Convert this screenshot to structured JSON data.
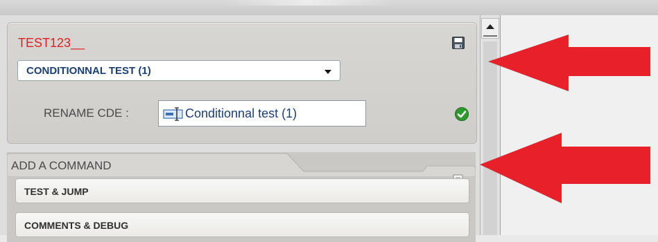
{
  "cde_panel": {
    "name": "TEST123__",
    "selected_command": "CONDITIONNAL TEST (1)",
    "rename_label": "RENAME CDE :",
    "rename_value": "Conditionnal test (1)"
  },
  "add_command": {
    "title": "ADD A COMMAND",
    "items": [
      "TEST & JUMP",
      "COMMENTS & DEBUG"
    ]
  },
  "icons": {
    "save": "floppy-disk-icon",
    "status": "green-checkmark-icon",
    "field": "text-field-icon",
    "minimize": "minimize-icon",
    "restore": "restore-icon",
    "scroll_up": "scroll-up-arrow-icon"
  },
  "colors": {
    "name_red": "#e02020",
    "command_blue": "#1b3f73",
    "annotation_arrow": "#e8202a",
    "check_green": "#2d9a2d"
  }
}
